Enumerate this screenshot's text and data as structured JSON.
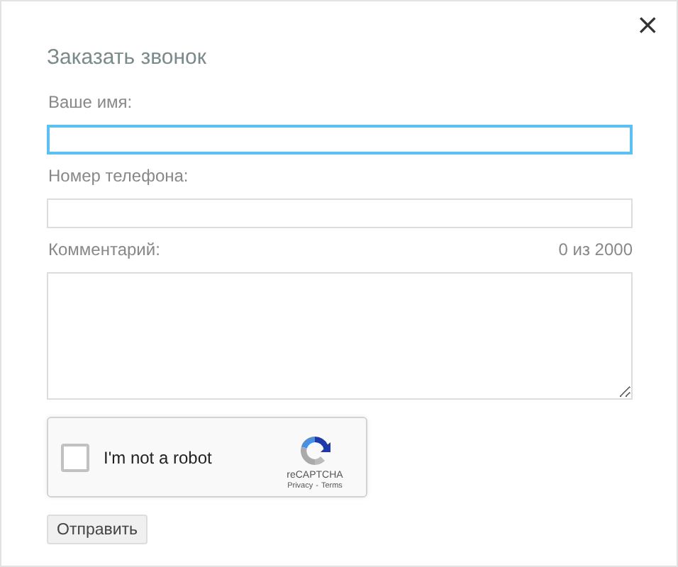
{
  "dialog": {
    "title": "Заказать звонок",
    "close": "×"
  },
  "fields": [
    {
      "kind": "input",
      "label": "Ваше имя:",
      "focused": true
    },
    {
      "kind": "input",
      "label": "Номер телефона:",
      "focused": false
    },
    {
      "kind": "textarea",
      "label": "Комментарий:",
      "counter": "0 из 2000",
      "focused": false
    }
  ],
  "captcha": {
    "label": "I'm not a robot",
    "checked": false,
    "brand": "reCAPTCHA",
    "privacy": "Privacy",
    "separator": "-",
    "terms": "Terms"
  },
  "submit": "Отправить"
}
